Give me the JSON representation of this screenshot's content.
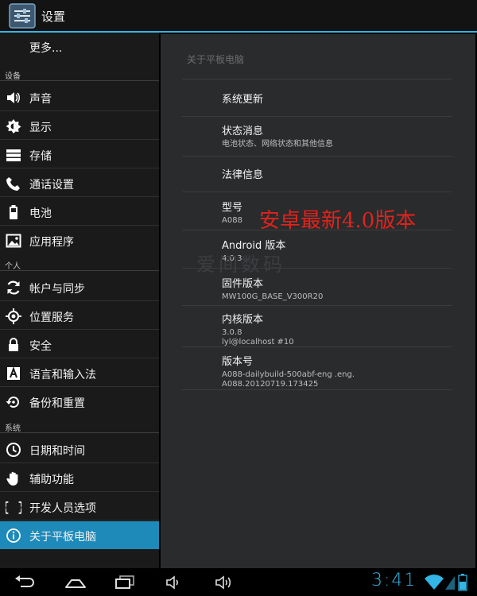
{
  "action_bar": {
    "title": "设置"
  },
  "sidebar": {
    "more": "更多...",
    "section_device": "设备",
    "section_personal": "个人",
    "section_system": "系统",
    "items": [
      {
        "label": "声音",
        "icon": "speaker-icon"
      },
      {
        "label": "显示",
        "icon": "brightness-icon"
      },
      {
        "label": "存储",
        "icon": "storage-icon"
      },
      {
        "label": "通话设置",
        "icon": "phone-icon"
      },
      {
        "label": "电池",
        "icon": "battery-icon"
      },
      {
        "label": "应用程序",
        "icon": "apps-icon"
      },
      {
        "label": "帐户与同步",
        "icon": "sync-icon"
      },
      {
        "label": "位置服务",
        "icon": "location-icon"
      },
      {
        "label": "安全",
        "icon": "lock-icon"
      },
      {
        "label": "语言和输入法",
        "icon": "language-icon"
      },
      {
        "label": "备份和重置",
        "icon": "backup-icon"
      },
      {
        "label": "日期和时间",
        "icon": "clock-icon"
      },
      {
        "label": "辅助功能",
        "icon": "hand-icon"
      },
      {
        "label": "开发人员选项",
        "icon": "braces-icon"
      },
      {
        "label": "关于平板电脑",
        "icon": "info-icon"
      }
    ]
  },
  "detail": {
    "title": "关于平板电脑",
    "system_update": "系统更新",
    "status": {
      "title": "状态消息",
      "summary": "电池状态、网络状态和其他信息"
    },
    "legal": "法律信息",
    "model": {
      "title": "型号",
      "value": "A088"
    },
    "android": {
      "title": "Android 版本",
      "value": "4.0.3"
    },
    "firmware": {
      "title": "固件版本",
      "value": "MW100G_BASE_V300R20"
    },
    "kernel": {
      "title": "内核版本",
      "value_line1": "3.0.8",
      "value_line2": "lyl@localhost #10"
    },
    "build": {
      "title": "版本号",
      "value_line1": "A088-dailybuild-500abf-eng .eng.",
      "value_line2": "A088.20120719.173425"
    },
    "overlay_red": "安卓最新4.0版本",
    "overlay_faint": "爱间数码"
  },
  "status_bar": {
    "time": "3:41"
  },
  "colors": {
    "accent": "#33b5e5",
    "selected": "#1e8ab9",
    "overlay_red": "#e0231c"
  }
}
